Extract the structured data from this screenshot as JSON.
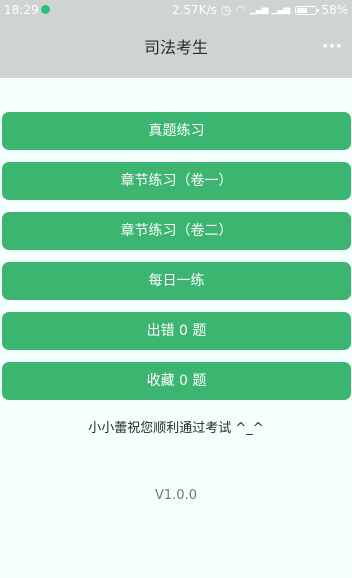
{
  "status_bar": {
    "time": "18:29",
    "network_speed": "2.57K/s",
    "battery": "58%",
    "battery_level": 0.58,
    "icons": [
      "notification-dot-icon",
      "alarm-icon",
      "wifi-icon",
      "signal-icon",
      "signal-icon",
      "battery-icon"
    ]
  },
  "header": {
    "title": "司法考生",
    "more_icon": "more-dots-icon"
  },
  "menu": [
    {
      "label": "真题练习"
    },
    {
      "label": "章节练习（卷一）"
    },
    {
      "label": "章节练习（卷二）"
    },
    {
      "label": "每日一练"
    },
    {
      "label": "出错 0 题"
    },
    {
      "label": "收藏 0 题"
    }
  ],
  "blessing": "小小蕾祝您顺利通过考试 ^_^",
  "version": "V1.0.0",
  "colors": {
    "accent": "#3cb570",
    "header_bg": "#d0d3d3",
    "page_bg": "#f3fffd"
  }
}
